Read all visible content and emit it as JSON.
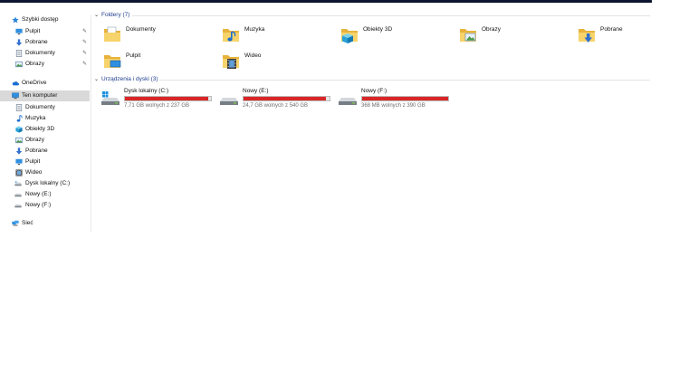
{
  "sidebar": {
    "quick_access": "Szybki dostęp",
    "quick_items": [
      {
        "label": "Pulpit",
        "icon": "desktop-icon"
      },
      {
        "label": "Pobrane",
        "icon": "download-icon"
      },
      {
        "label": "Dokumenty",
        "icon": "document-icon"
      },
      {
        "label": "Obrazy",
        "icon": "pictures-icon"
      }
    ],
    "onedrive": "OneDrive",
    "this_pc": "Ten komputer",
    "pc_items": [
      {
        "label": "Dokumenty",
        "icon": "document-icon"
      },
      {
        "label": "Muzyka",
        "icon": "music-icon"
      },
      {
        "label": "Obiekty 3D",
        "icon": "cube-icon"
      },
      {
        "label": "Obrazy",
        "icon": "pictures-icon"
      },
      {
        "label": "Pobrane",
        "icon": "download-icon"
      },
      {
        "label": "Pulpit",
        "icon": "desktop-icon"
      },
      {
        "label": "Wideo",
        "icon": "video-icon"
      },
      {
        "label": "Dysk lokalny (C:)",
        "icon": "drive-icon"
      },
      {
        "label": "Nowy (E:)",
        "icon": "drive-icon"
      },
      {
        "label": "Nowy (F:)",
        "icon": "drive-icon"
      }
    ],
    "network": "Sieć"
  },
  "main": {
    "folders_header": "Foldery (7)",
    "folders": [
      {
        "label": "Dokumenty",
        "icon": "documents-folder-icon"
      },
      {
        "label": "Muzyka",
        "icon": "music-folder-icon"
      },
      {
        "label": "Obiekty 3D",
        "icon": "3d-objects-folder-icon"
      },
      {
        "label": "Obrazy",
        "icon": "pictures-folder-icon"
      },
      {
        "label": "Pobrane",
        "icon": "downloads-folder-icon"
      },
      {
        "label": "Pulpit",
        "icon": "desktop-folder-icon"
      },
      {
        "label": "Wideo",
        "icon": "videos-folder-icon"
      }
    ],
    "drives_header": "Urządzenia i dyski (3)",
    "drives": [
      {
        "name": "Dysk lokalny (C:)",
        "free": "7,71 GB wolnych z 237 GB",
        "used_fraction": 0.967,
        "icon": "windows-drive-icon"
      },
      {
        "name": "Nowy (E:)",
        "free": "24,7 GB wolnych z 540 GB",
        "used_fraction": 0.954,
        "icon": "hdd-icon"
      },
      {
        "name": "Nowy (F:)",
        "free": "368 MB wolnych z 390 GB",
        "used_fraction": 0.999,
        "icon": "hdd-icon"
      }
    ]
  },
  "colors": {
    "accent": "#1f3e8c",
    "bar_full": "#da2626",
    "selection": "#d9d9d9",
    "topbar": "#0d1530"
  }
}
